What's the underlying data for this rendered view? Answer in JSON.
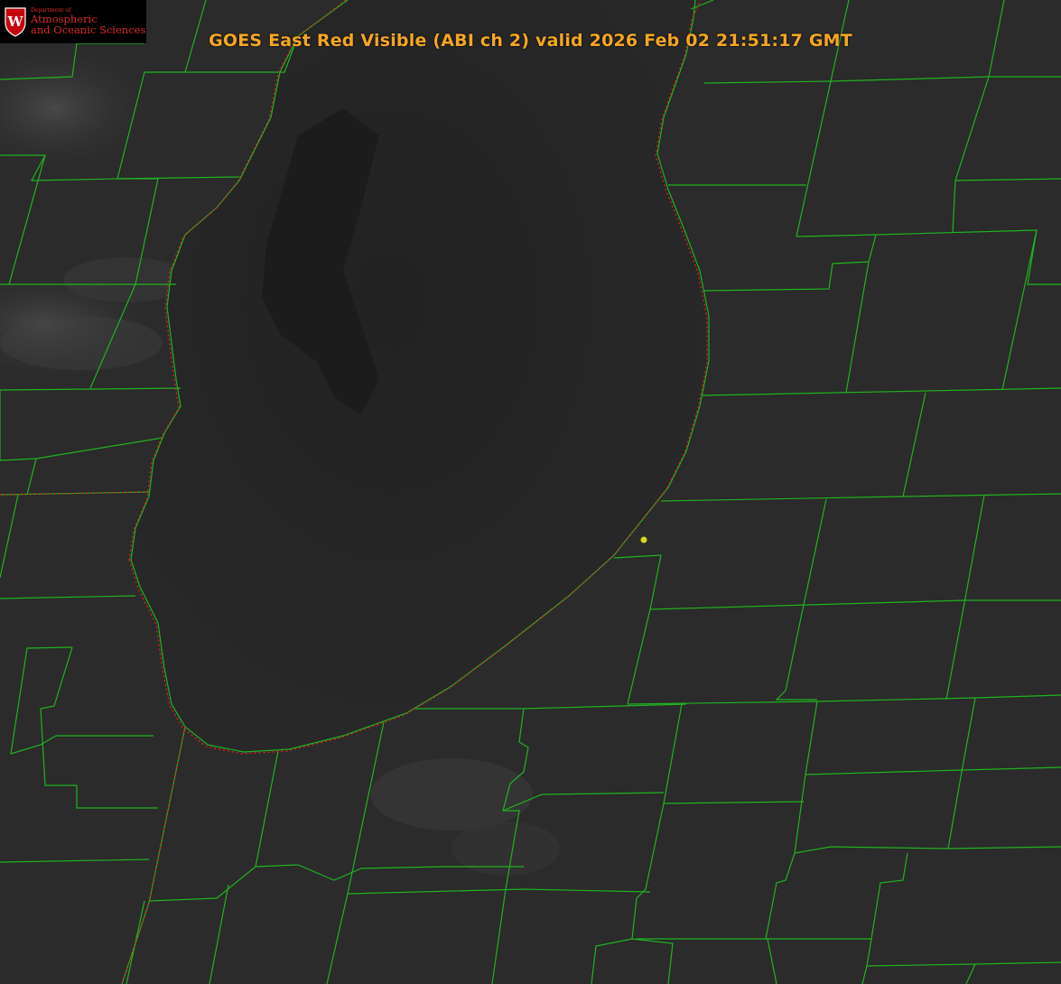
{
  "title": "GOES East Red Visible (ABI ch 2) valid 2026 Feb 02 21:51:17 GMT",
  "logo": {
    "letter": "W",
    "dept": "Department of",
    "line1": "Atmospheric",
    "line2": "and Oceanic Sciences"
  },
  "colors": {
    "title": "#f5a623",
    "county_lines": "#22b022",
    "state_lines": "#e02020",
    "marker": "#d7d71e",
    "logo_text": "#d92b2b"
  }
}
